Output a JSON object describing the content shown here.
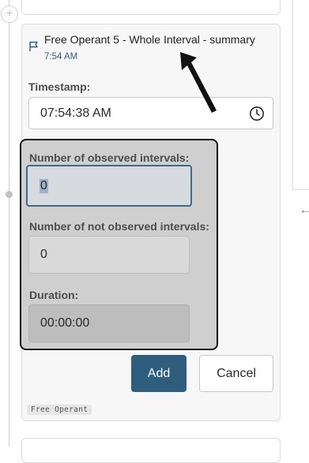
{
  "entry": {
    "title": "Free Operant 5 - Whole Interval - summary",
    "time": "7:54 AM",
    "icon": "flag-icon",
    "tag": "Free Operant"
  },
  "form": {
    "timestamp_label": "Timestamp:",
    "timestamp_value": "07:54:38 AM",
    "timestamp_icon": "clock-icon",
    "observed_label": "Number of observed intervals:",
    "observed_value": "0",
    "not_observed_label": "Number of not observed intervals:",
    "not_observed_value": "0",
    "duration_label": "Duration:",
    "duration_value": "00:00:00"
  },
  "actions": {
    "add_label": "Add",
    "cancel_label": "Cancel"
  },
  "timeline": {
    "add_icon": "plus-icon"
  },
  "colors": {
    "primary": "#2e5d7d",
    "time_text": "#2f5f86",
    "highlight_bg": "#cfcfcf"
  }
}
